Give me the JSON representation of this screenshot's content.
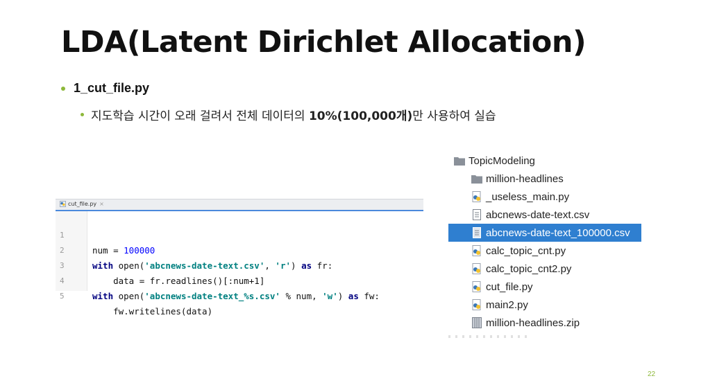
{
  "slide": {
    "title": "LDA(Latent Dirichlet Allocation)",
    "bullet1": "1_cut_file.py",
    "bullet2_prefix": "지도학습 시간이 오래 걸려서 전체 데이터의 ",
    "bullet2_em": "10%(100,000개)",
    "bullet2_suffix": "만 사용하여 실습",
    "page_number": "22",
    "accent_color": "#8db83a"
  },
  "editor": {
    "tab_label": "cut_file.py",
    "tab_close": "×",
    "line_numbers": [
      "1",
      "2",
      "3",
      "4",
      "5"
    ],
    "code": {
      "l1_a": "num = ",
      "l1_num": "100000",
      "l2_kw": "with",
      "l2_a": " open(",
      "l2_s1": "'abcnews-date-text.csv'",
      "l2_b": ", ",
      "l2_s2": "'r'",
      "l2_c": ") ",
      "l2_kw2": "as",
      "l2_d": " fr:",
      "l3": "    data = fr.readlines()[:num+1]",
      "l4_kw": "with",
      "l4_a": " open(",
      "l4_s1": "'abcnews-date-text_%s.csv'",
      "l4_b": " % num, ",
      "l4_s2": "'w'",
      "l4_c": ") ",
      "l4_kw2": "as",
      "l4_d": " fw:",
      "l5": "    fw.writelines(data)"
    }
  },
  "tree": {
    "items": [
      {
        "label": "TopicModeling",
        "icon": "folder-icon"
      },
      {
        "label": "million-headlines",
        "icon": "folder-icon"
      },
      {
        "label": "_useless_main.py",
        "icon": "python-file-icon"
      },
      {
        "label": "abcnews-date-text.csv",
        "icon": "text-file-icon"
      },
      {
        "label": "abcnews-date-text_100000.csv",
        "icon": "text-file-icon",
        "selected": true
      },
      {
        "label": "calc_topic_cnt.py",
        "icon": "python-file-icon"
      },
      {
        "label": "calc_topic_cnt2.py",
        "icon": "python-file-icon"
      },
      {
        "label": "cut_file.py",
        "icon": "python-file-icon"
      },
      {
        "label": "main2.py",
        "icon": "python-file-icon"
      },
      {
        "label": "million-headlines.zip",
        "icon": "archive-icon"
      }
    ],
    "selected_color": "#2f7fd0"
  }
}
